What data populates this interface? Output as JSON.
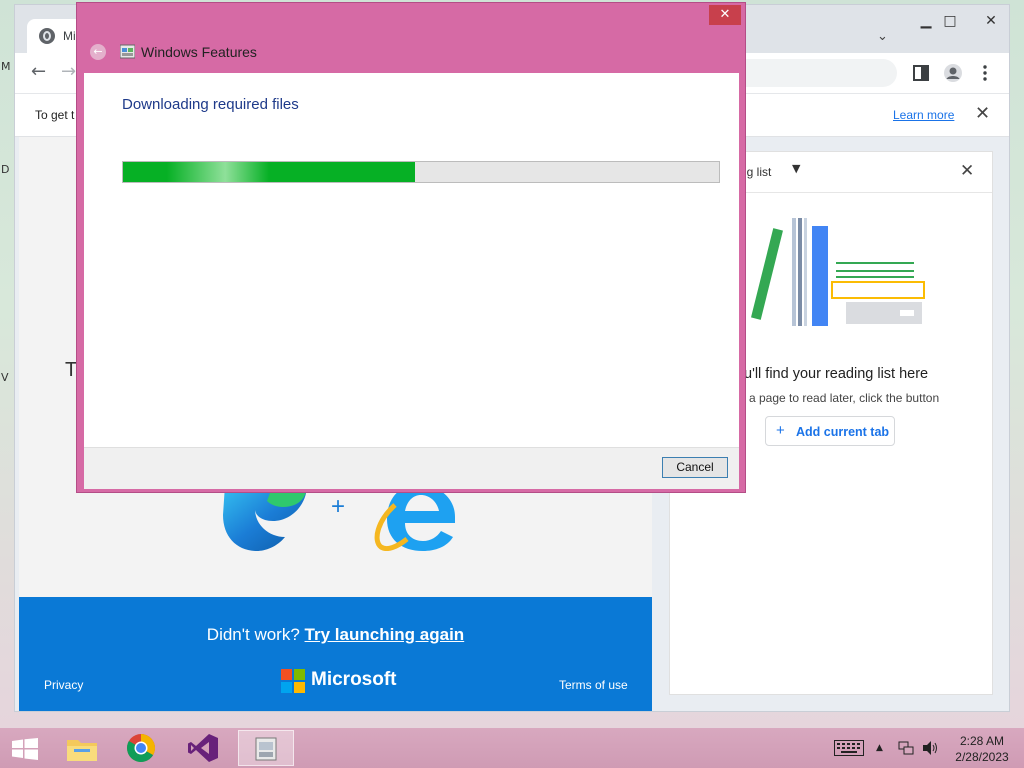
{
  "desktop": {
    "glyphs": [
      "M",
      "D",
      "V"
    ]
  },
  "browser": {
    "tab_title": "Mi",
    "window_controls": {
      "minimize": "▁",
      "maximize": "□",
      "close": "✕"
    },
    "tab_list_chevron": "⌄",
    "nav": {
      "back": "←",
      "forward": "→"
    },
    "infobar": {
      "text": "To get t",
      "learn_more": "Learn more",
      "close": "✕"
    },
    "page": {
      "partial_text": "T",
      "footer": {
        "didnt_work": "Didn't work?",
        "try_again": "Try launching again",
        "privacy": "Privacy",
        "brand": "Microsoft",
        "terms": "Terms of use"
      },
      "plus": "+"
    },
    "side_panel": {
      "title": "ng list",
      "dropdown": "▼",
      "close": "✕",
      "heading": "u'll find your reading list here",
      "subtext": "a page to read later, click the button",
      "add_button": "Add current tab",
      "add_plus": "+"
    }
  },
  "dialog": {
    "title": "Windows Features",
    "close": "✕",
    "back": "←",
    "heading": "Downloading required files",
    "progress": 0.49,
    "cancel": "Cancel"
  },
  "taskbar": {
    "apps": [
      "file-explorer",
      "chrome",
      "visual-studio",
      "windows-features"
    ],
    "active": "windows-features",
    "tray": {
      "up": "▲"
    },
    "time": "2:28 AM",
    "date": "2/28/2023"
  },
  "colors": {
    "dialog_frame": "#d66aa5",
    "progress": "#06b025",
    "ms_blue": "#0a79d6",
    "link": "#1a73e8"
  }
}
